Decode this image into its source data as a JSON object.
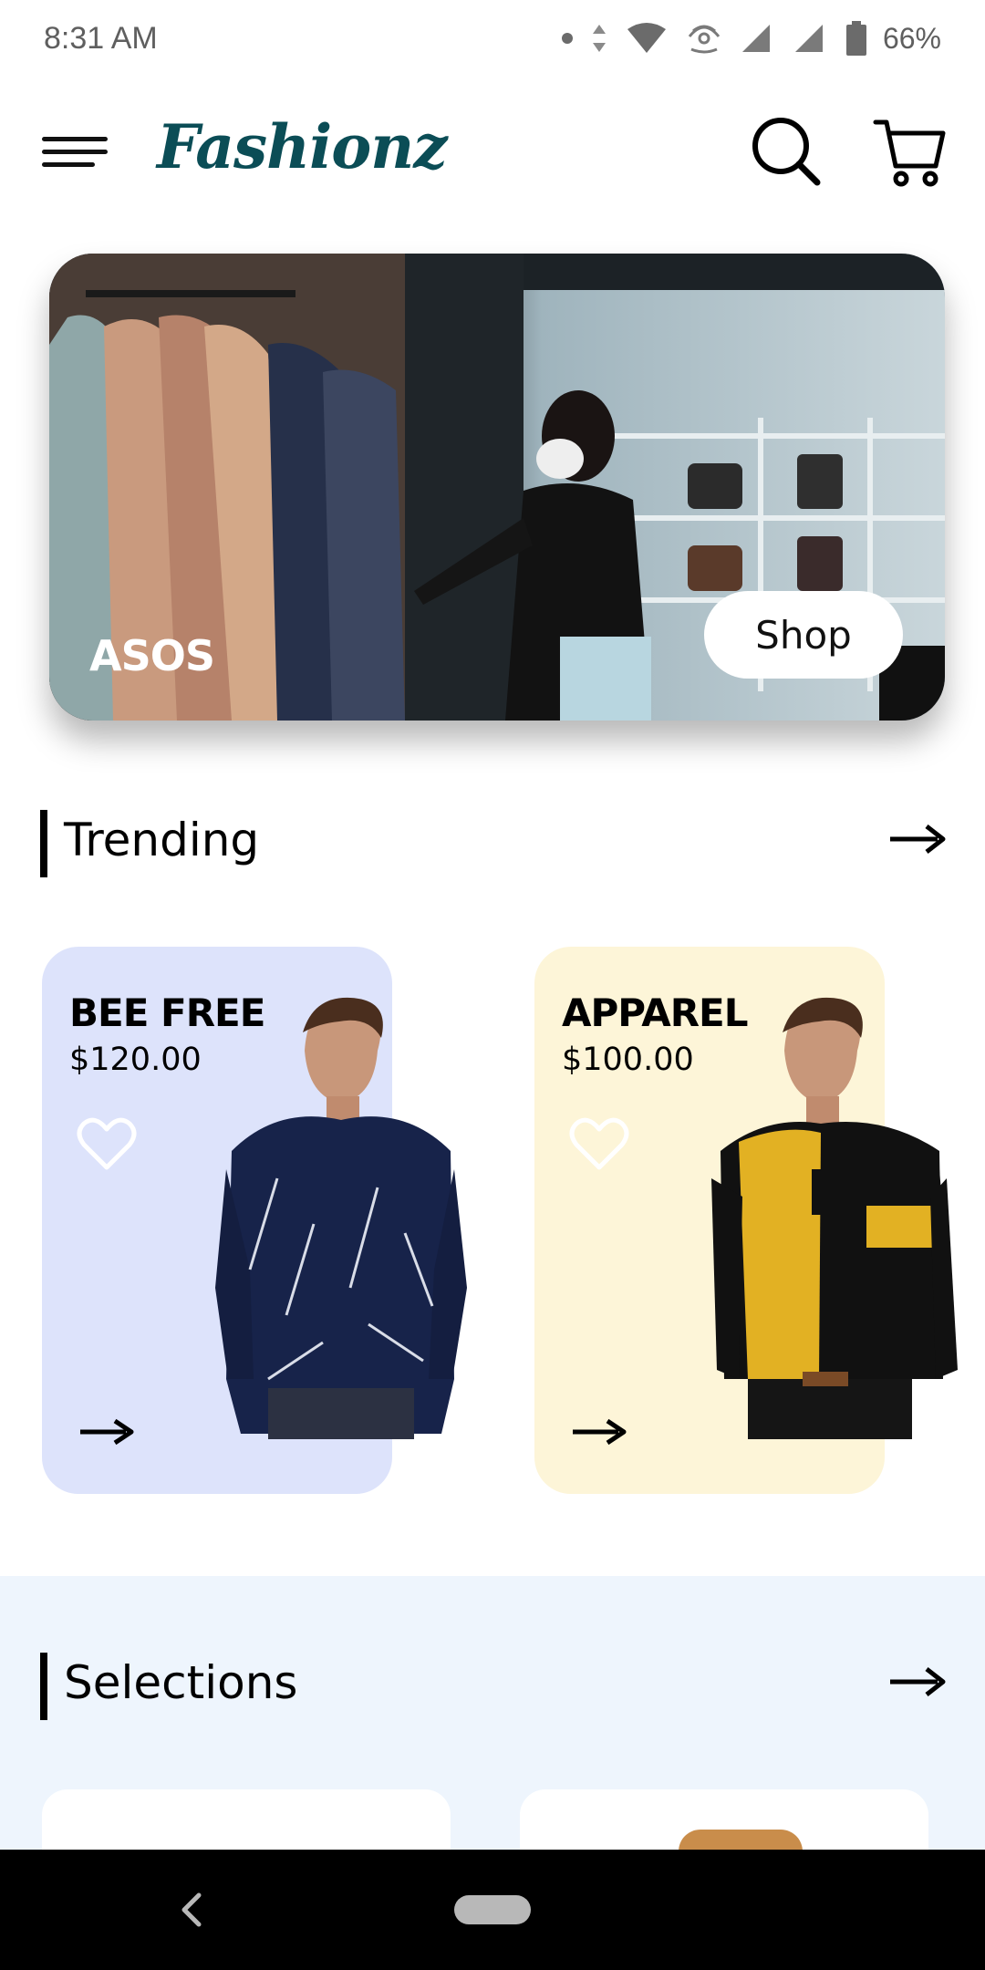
{
  "status_bar": {
    "time": "8:31 AM",
    "battery": "66%",
    "icons": [
      "dot-icon",
      "data-arrows-icon",
      "wifi-icon",
      "hotspot-icon",
      "signal-icon",
      "signal-icon",
      "battery-icon"
    ]
  },
  "header": {
    "brand": "Fashionz",
    "icons": [
      "hamburger-menu-icon",
      "search-icon",
      "cart-icon"
    ],
    "brand_color": "#0b4d56"
  },
  "hero": {
    "brand": "ASOS",
    "button_label": "Shop"
  },
  "trending": {
    "title": "Trending",
    "products": [
      {
        "name": "BEE FREE",
        "price": "$120.00",
        "card_color": "#dde3fb"
      },
      {
        "name": "APPAREL",
        "price": "$100.00",
        "card_color": "#fdf5d8"
      }
    ]
  },
  "selections": {
    "title": "Selections",
    "background_color": "#eef5fd"
  },
  "nav_bar": {
    "icons": [
      "back-icon",
      "home-pill-icon"
    ]
  }
}
